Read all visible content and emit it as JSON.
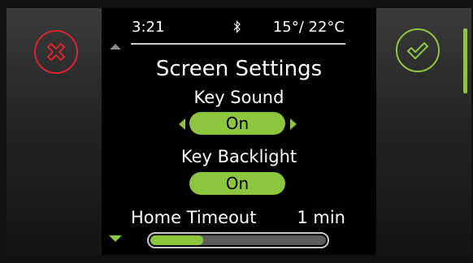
{
  "colors": {
    "accent": "#8cc63f",
    "cancel": "#d9252b",
    "screen_bg": "#000000",
    "text": "#ffffff"
  },
  "buttons": {
    "cancel": {
      "icon": "x-circle-icon"
    },
    "confirm": {
      "icon": "checkmark-circle-icon"
    }
  },
  "status": {
    "time": "3:21",
    "bluetooth_icon": "bluetooth-icon",
    "temperature": "15°/ 22°C"
  },
  "screen": {
    "title": "Screen Settings",
    "key_sound": {
      "label": "Key Sound",
      "value": "On"
    },
    "key_backlight": {
      "label": "Key Backlight",
      "value": "On"
    },
    "home_timeout": {
      "label": "Home Timeout",
      "value": "1 min",
      "level": 0.3
    }
  }
}
